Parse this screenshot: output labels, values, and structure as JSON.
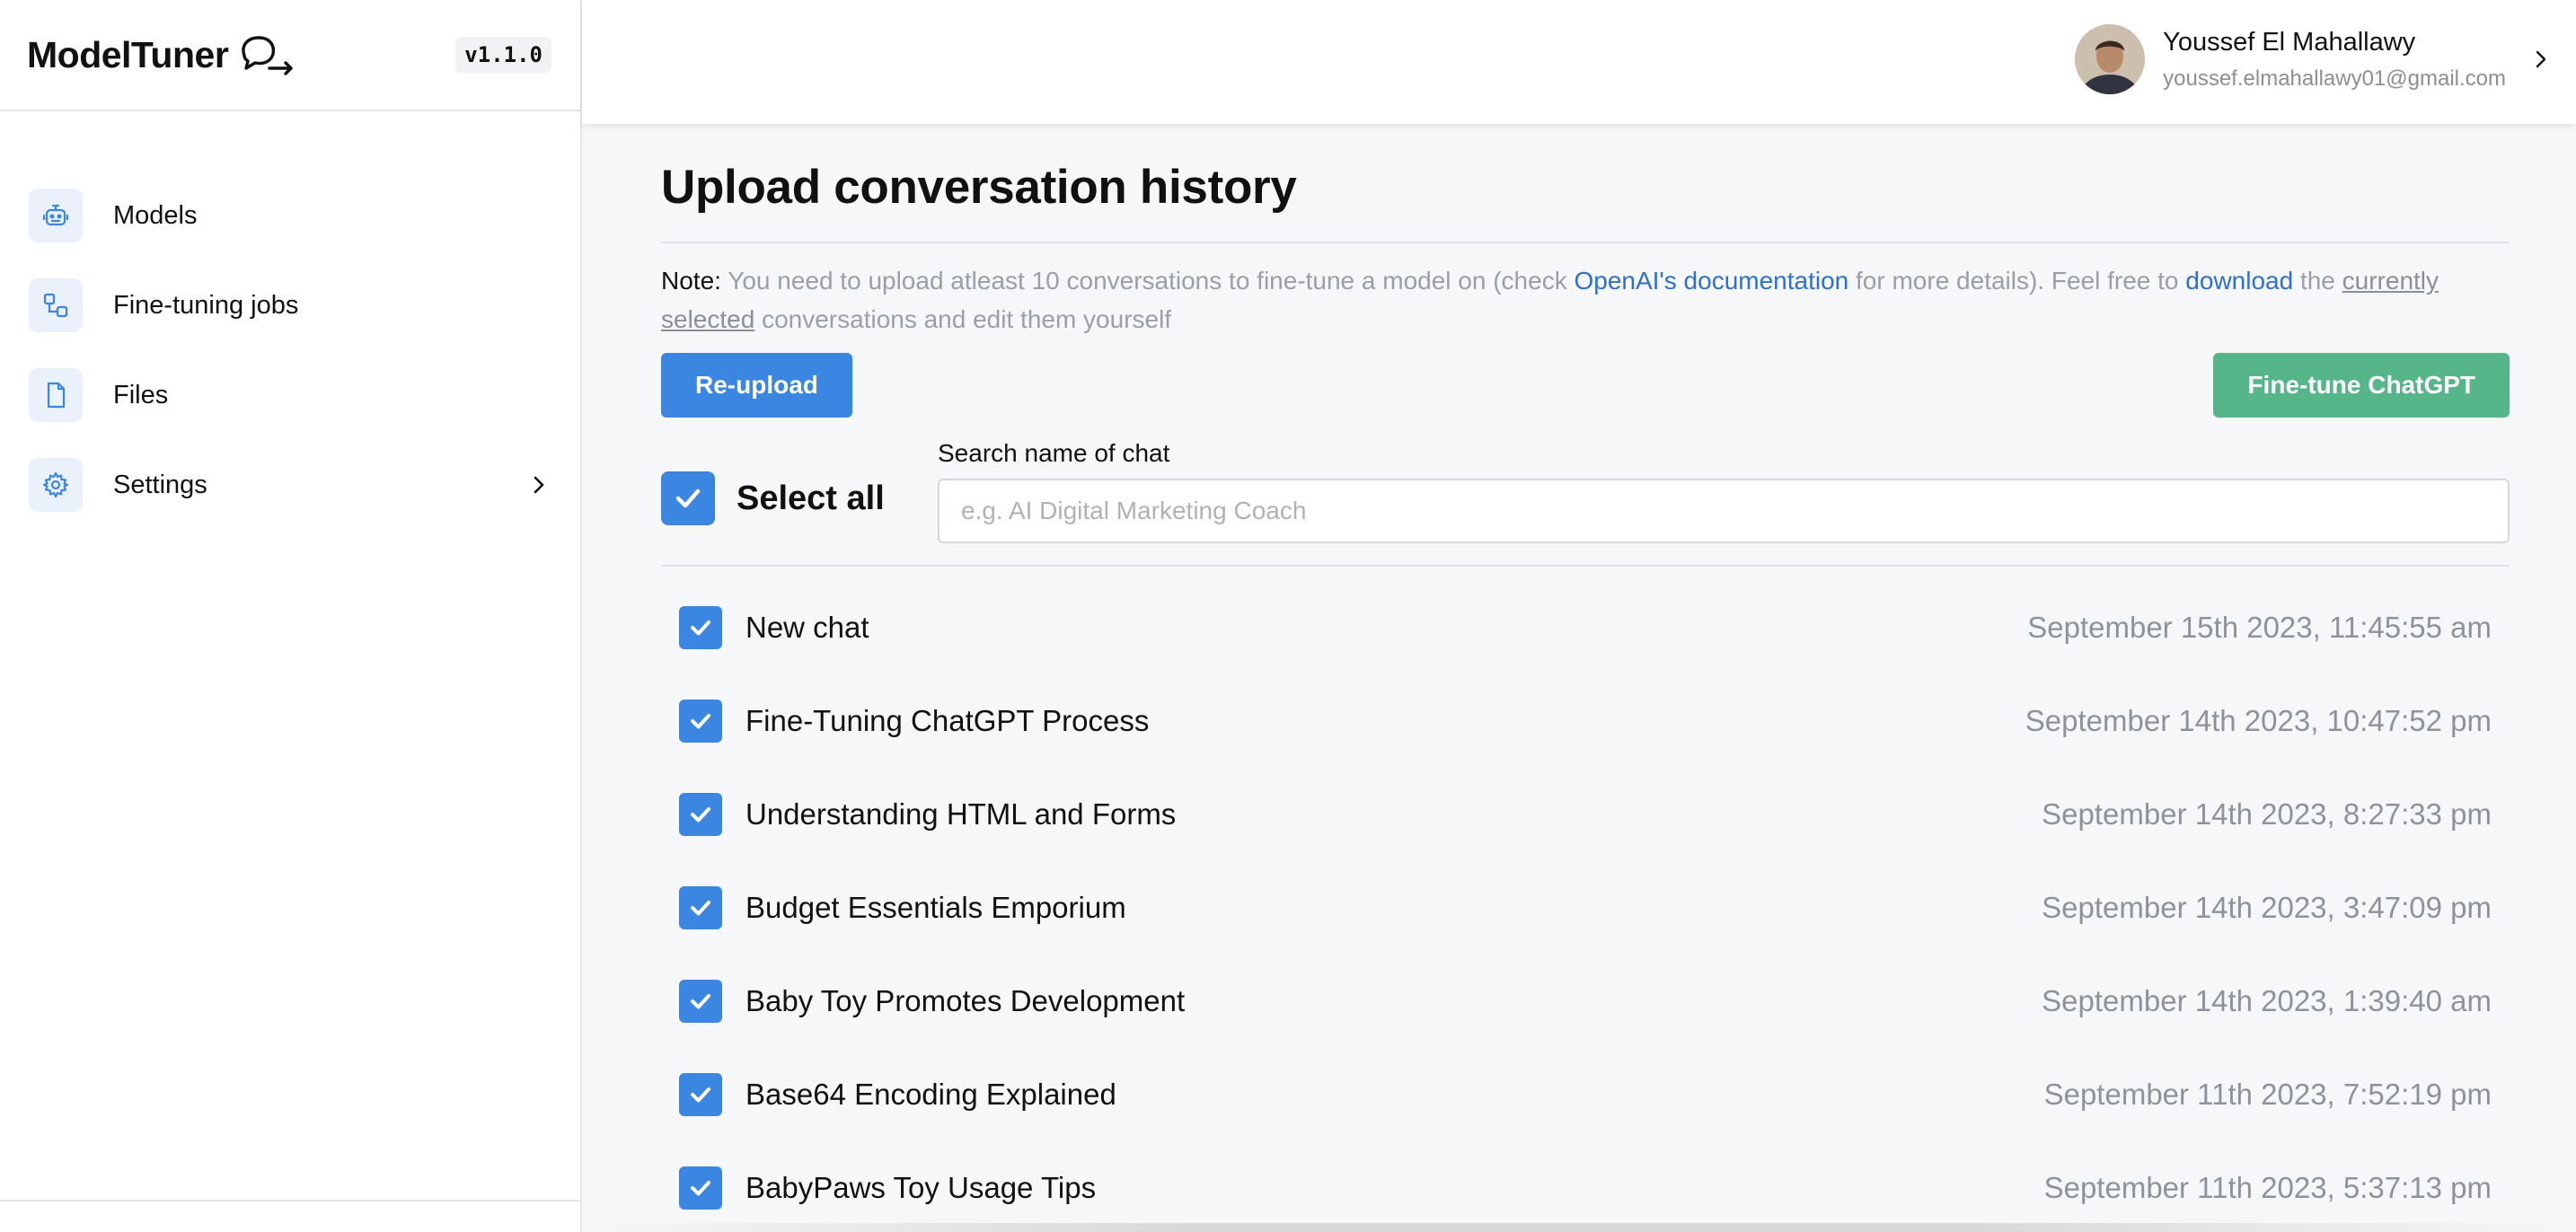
{
  "sidebar": {
    "brand": "ModelTuner",
    "version": "v1.1.0",
    "items": [
      {
        "label": "Models",
        "icon": "robot-icon"
      },
      {
        "label": "Fine-tuning jobs",
        "icon": "workflow-icon"
      },
      {
        "label": "Files",
        "icon": "file-icon"
      },
      {
        "label": "Settings",
        "icon": "gear-icon"
      }
    ]
  },
  "user": {
    "name": "Youssef El Mahallawy",
    "email": "youssef.elmahallawy01@gmail.com"
  },
  "main": {
    "title": "Upload conversation history",
    "note": {
      "label": "Note:",
      "text1": " You need to upload atleast 10 conversations to fine-tune a model on (check ",
      "link1": "OpenAI's documentation",
      "text2": " for more details). Feel free to ",
      "link2": "download",
      "text3": " the ",
      "underline": "currently selected",
      "text4": " conversations and edit them yourself"
    },
    "reupload_label": "Re-upload",
    "finetune_label": "Fine-tune ChatGPT",
    "select_all_label": "Select all",
    "search": {
      "label": "Search name of chat",
      "placeholder": "e.g. AI Digital Marketing Coach",
      "value": ""
    },
    "chats": [
      {
        "name": "New chat",
        "date": "September 15th 2023, 11:45:55 am",
        "checked": true
      },
      {
        "name": "Fine-Tuning ChatGPT Process",
        "date": "September 14th 2023, 10:47:52 pm",
        "checked": true
      },
      {
        "name": "Understanding HTML and Forms",
        "date": "September 14th 2023, 8:27:33 pm",
        "checked": true
      },
      {
        "name": "Budget Essentials Emporium",
        "date": "September 14th 2023, 3:47:09 pm",
        "checked": true
      },
      {
        "name": "Baby Toy Promotes Development",
        "date": "September 14th 2023, 1:39:40 am",
        "checked": true
      },
      {
        "name": "Base64 Encoding Explained",
        "date": "September 11th 2023, 7:52:19 pm",
        "checked": true
      },
      {
        "name": "BabyPaws Toy Usage Tips",
        "date": "September 11th 2023, 5:37:13 pm",
        "checked": true
      }
    ]
  },
  "colors": {
    "accent": "#3a86e0",
    "success": "#56b689",
    "link": "#2f6fce",
    "icon_bg": "#eaf1fb"
  }
}
